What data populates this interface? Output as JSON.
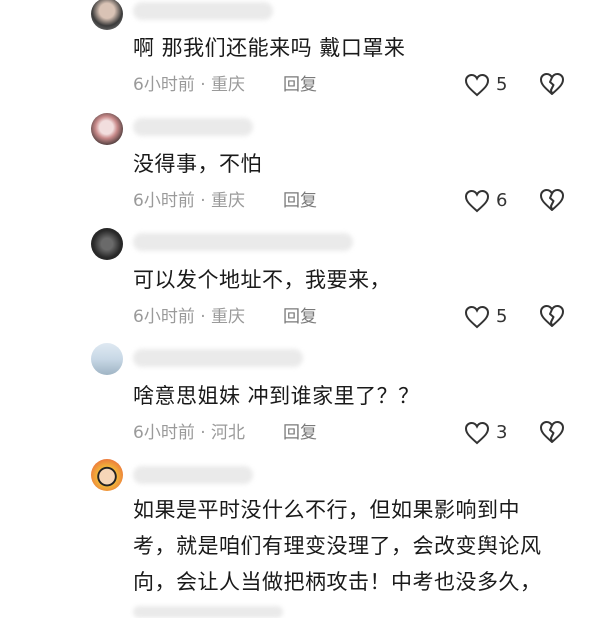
{
  "colors": {
    "text": "#1a1a1a",
    "meta": "#9a9a9a",
    "icon": "#333333"
  },
  "comments": [
    {
      "content": "啊 那我们还能来吗 戴口罩来",
      "time": "6小时前",
      "location": "重庆",
      "reply_label": "回复",
      "likes": "5"
    },
    {
      "content": "没得事，不怕",
      "time": "6小时前",
      "location": "重庆",
      "reply_label": "回复",
      "likes": "6"
    },
    {
      "content": "可以发个地址不，我要来，",
      "time": "6小时前",
      "location": "重庆",
      "reply_label": "回复",
      "likes": "5"
    },
    {
      "content": "啥意思姐妹 冲到谁家里了？？",
      "time": "6小时前",
      "location": "河北",
      "reply_label": "回复",
      "likes": "3"
    },
    {
      "content": "如果是平时没什么不行，但如果影响到中\n考，就是咱们有理变没理了，会改变舆论风\n向，会让人当做把柄攻击！中考也没多久，"
    }
  ]
}
